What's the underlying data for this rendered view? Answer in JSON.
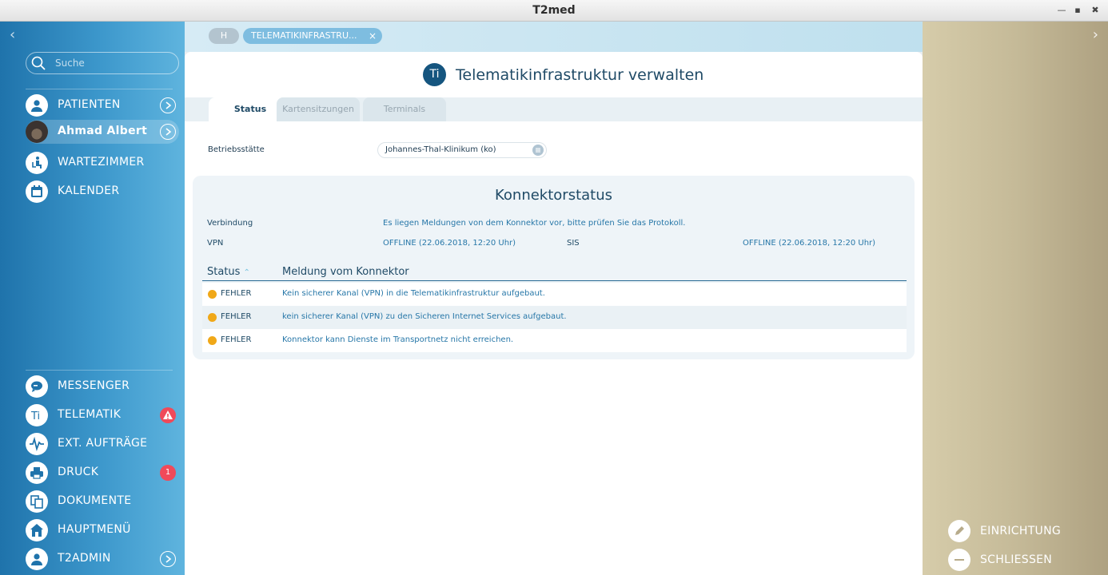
{
  "window": {
    "title": "T2med"
  },
  "sidebar": {
    "search_placeholder": "Suche",
    "top_items": [
      {
        "label": "PATIENTEN"
      },
      {
        "label": "Ahmad Albert"
      },
      {
        "label": "WARTEZIMMER"
      },
      {
        "label": "KALENDER"
      }
    ],
    "bottom_items": [
      {
        "label": "MESSENGER"
      },
      {
        "label": "TELEMATIK"
      },
      {
        "label": "EXT. AUFTRÄGE"
      },
      {
        "label": "DRUCK",
        "badge": "1"
      },
      {
        "label": "DOKUMENTE"
      },
      {
        "label": "HAUPTMENÜ"
      },
      {
        "label": "T2ADMIN"
      }
    ]
  },
  "breadcrumb": {
    "home": "H",
    "current": "TELEMATIKINFRASTRU...",
    "close": "×"
  },
  "page": {
    "logo_text": "Ti",
    "title": "Telematikinfrastruktur verwalten",
    "tabs": [
      "Status",
      "Kartensitzungen",
      "Terminals"
    ],
    "betriebsstaette_label": "Betriebsstätte",
    "betriebsstaette_value": "Johannes-Thal-Klinikum (ko)"
  },
  "konnektor": {
    "title": "Konnektorstatus",
    "verbindung_label": "Verbindung",
    "verbindung_value": "Es liegen Meldungen von dem Konnektor vor, bitte prüfen Sie das Protokoll.",
    "vpn_label": "VPN",
    "vpn_value": "OFFLINE (22.06.2018, 12:20 Uhr)",
    "sis_label": "SIS",
    "sis_value": "OFFLINE (22.06.2018, 12:20 Uhr)",
    "table": {
      "col_status": "Status",
      "col_message": "Meldung vom Konnektor",
      "rows": [
        {
          "status": "FEHLER",
          "message": "Kein sicherer Kanal (VPN) in die Telematikinfrastruktur aufgebaut."
        },
        {
          "status": "FEHLER",
          "message": "kein sicherer Kanal (VPN) zu den Sicheren Internet Services aufgebaut."
        },
        {
          "status": "FEHLER",
          "message": "Konnektor kann Dienste im Transportnetz nicht erreichen."
        }
      ]
    }
  },
  "right_panel": {
    "items": [
      {
        "label": "EINRICHTUNG"
      },
      {
        "label": "SCHLIESSEN"
      }
    ]
  },
  "colors": {
    "sidebar_accent": "#3d98cc",
    "error_dot": "#f0a818",
    "badge": "#f04a5a",
    "ti_logo": "#15557f"
  }
}
